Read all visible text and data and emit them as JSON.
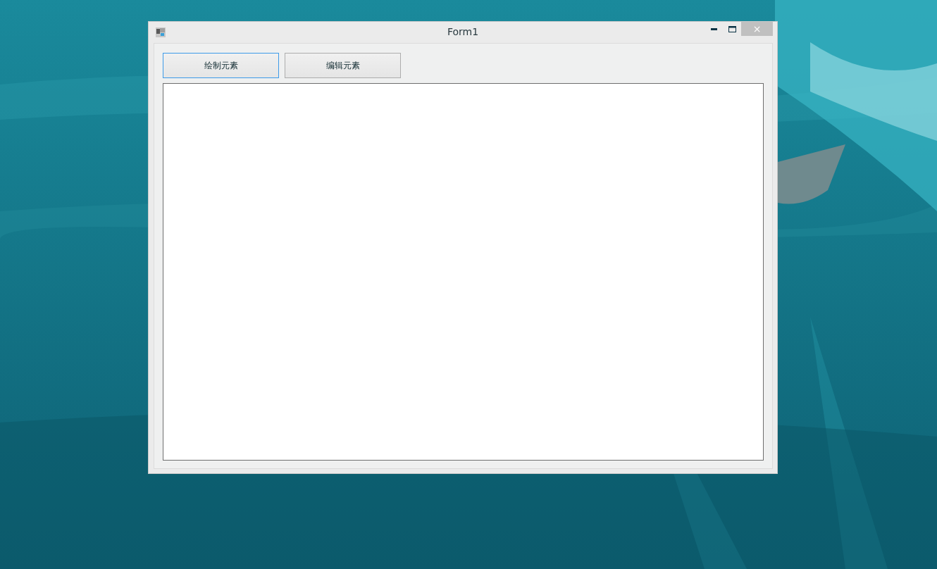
{
  "window": {
    "title": "Form1",
    "close_glyph": "×"
  },
  "buttons": [
    {
      "label": "绘制元素",
      "focused": true
    },
    {
      "label": "编辑元素",
      "focused": false
    }
  ]
}
